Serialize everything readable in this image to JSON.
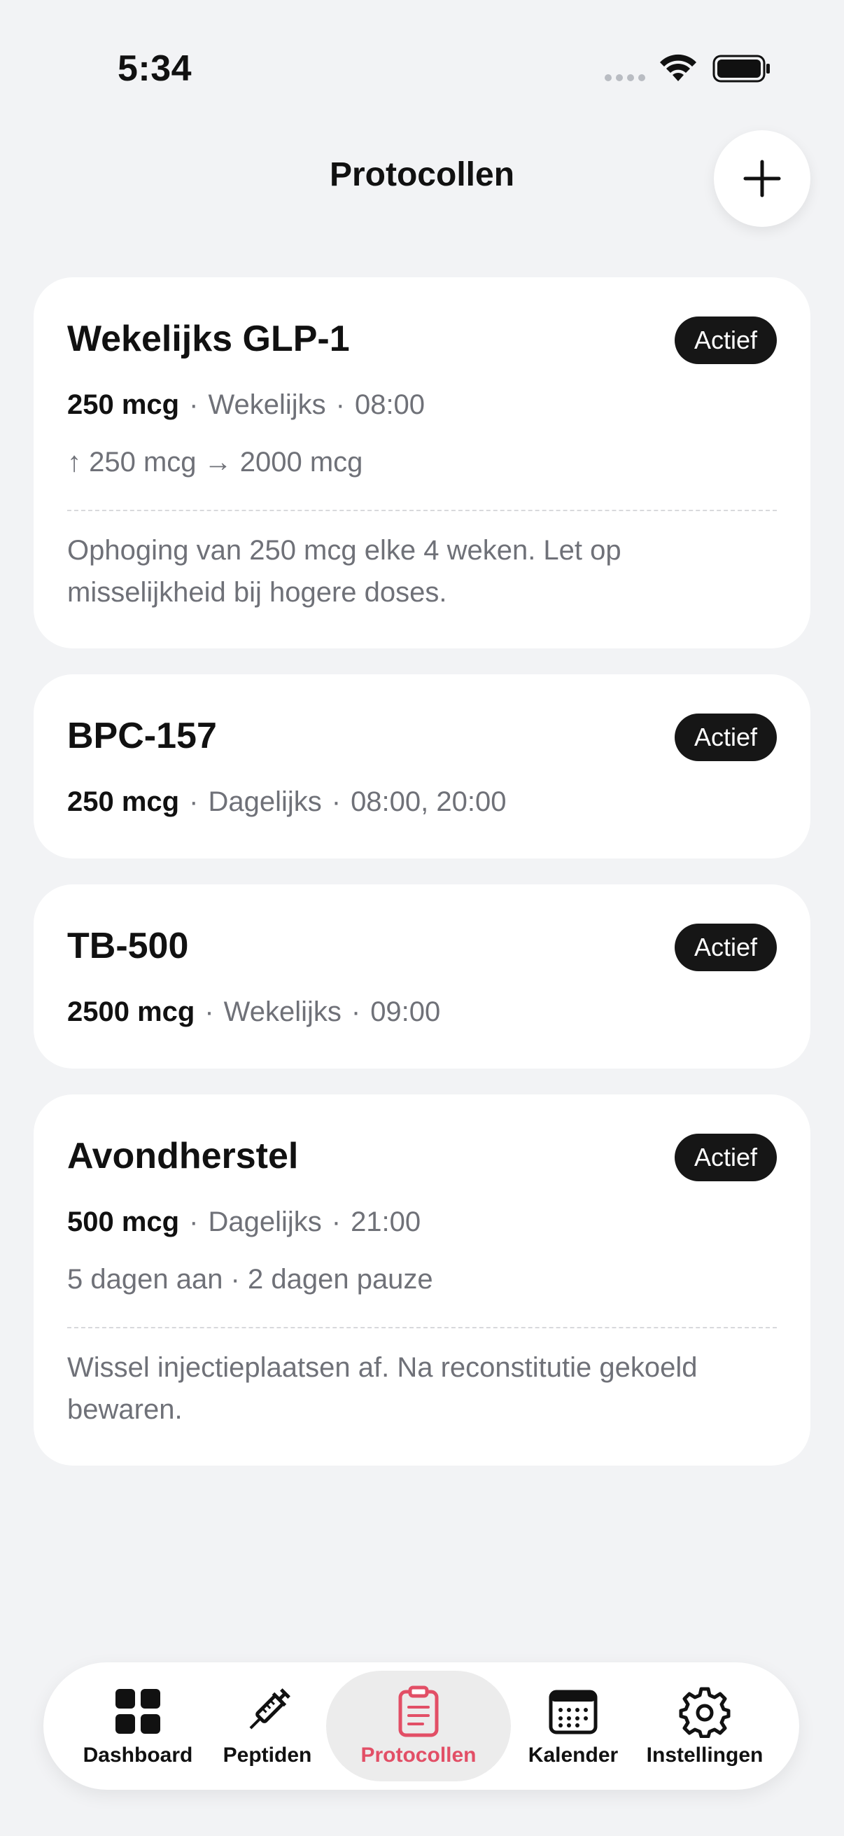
{
  "status_bar": {
    "time": "5:34"
  },
  "header": {
    "title": "Protocollen"
  },
  "protocols": [
    {
      "name": "Wekelijks GLP-1",
      "status": "Actief",
      "dose": "250 mcg",
      "frequency": "Wekelijks",
      "times": "08:00",
      "detail": "↑ 250 mcg → 2000 mcg",
      "note": "Ophoging van 250 mcg elke 4 weken. Let op misselijkheid bij hogere doses."
    },
    {
      "name": "BPC-157",
      "status": "Actief",
      "dose": "250 mcg",
      "frequency": "Dagelijks",
      "times": "08:00, 20:00"
    },
    {
      "name": "TB-500",
      "status": "Actief",
      "dose": "2500 mcg",
      "frequency": "Wekelijks",
      "times": "09:00"
    },
    {
      "name": "Avondherstel",
      "status": "Actief",
      "dose": "500 mcg",
      "frequency": "Dagelijks",
      "times": "21:00",
      "detail": "5 dagen aan · 2 dagen pauze",
      "note": "Wissel injectieplaatsen af. Na reconstitutie gekoeld bewaren."
    }
  ],
  "tabs": [
    {
      "label": "Dashboard",
      "icon": "grid-icon"
    },
    {
      "label": "Peptiden",
      "icon": "syringe-icon"
    },
    {
      "label": "Protocollen",
      "icon": "clipboard-icon",
      "active": true
    },
    {
      "label": "Kalender",
      "icon": "calendar-icon"
    },
    {
      "label": "Instellingen",
      "icon": "gear-icon"
    }
  ],
  "colors": {
    "accent": "#e24f66",
    "badge_bg": "#161616",
    "background": "#f2f3f5"
  }
}
